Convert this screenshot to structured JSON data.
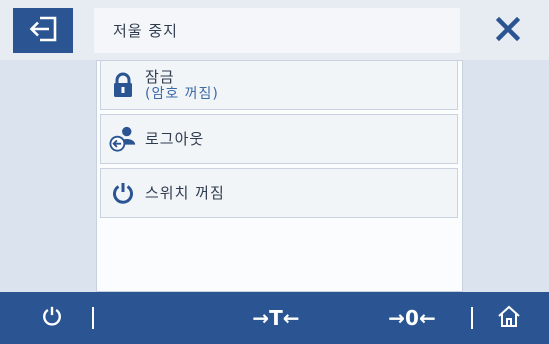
{
  "header": {
    "title": "저울 중지",
    "back_icon": "exit-arrow-icon",
    "close_icon": "close-icon"
  },
  "menu": {
    "items": [
      {
        "label": "잠금",
        "sub": "(암호 꺼짐)",
        "icon": "lock-icon"
      },
      {
        "label": "로그아웃",
        "icon": "logout-user-icon"
      },
      {
        "label": "스위치 꺼짐",
        "icon": "power-icon"
      }
    ]
  },
  "footer": {
    "power_icon": "power-icon",
    "tare_label": "→T←",
    "zero_label": "→0←",
    "home_icon": "home-icon"
  },
  "colors": {
    "accent": "#2a5592",
    "side_panel": "#dbe4ee",
    "header_bg": "#e7ebf2",
    "subtext": "#3b6aa8"
  }
}
